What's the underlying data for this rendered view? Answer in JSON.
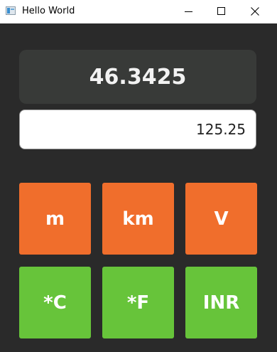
{
  "window": {
    "title": "Hello World",
    "minimize_icon": "minimize-icon",
    "maximize_icon": "maximize-icon",
    "close_icon": "close-icon"
  },
  "display": {
    "value": "46.3425"
  },
  "input": {
    "value": "125.25"
  },
  "buttons": {
    "row1": [
      {
        "label": "m"
      },
      {
        "label": "km"
      },
      {
        "label": "V"
      }
    ],
    "row2": [
      {
        "label": "*C"
      },
      {
        "label": "*F"
      },
      {
        "label": "INR"
      }
    ]
  },
  "colors": {
    "orange": "#f06e2c",
    "green": "#67c43a",
    "display_bg": "#383a38",
    "window_bg": "#2a2a2a"
  }
}
